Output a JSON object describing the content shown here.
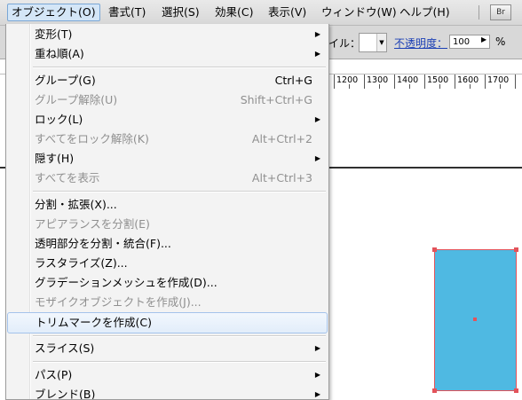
{
  "menubar": {
    "items": [
      {
        "label": "オブジェクト(O)",
        "active": true
      },
      {
        "label": "書式(T)"
      },
      {
        "label": "選択(S)"
      },
      {
        "label": "効果(C)"
      },
      {
        "label": "表示(V)"
      },
      {
        "label": "ウィンドウ(W)"
      },
      {
        "label": "ヘルプ(H)"
      }
    ],
    "bridge_label": "Br"
  },
  "controlbar": {
    "style_label": "イル：",
    "opacity_label": "不透明度：",
    "opacity_value": "100",
    "percent": "%"
  },
  "ruler": {
    "labels": [
      "1200",
      "1300",
      "1400",
      "1500",
      "1600",
      "1700"
    ]
  },
  "menu": {
    "items": [
      {
        "label": "変形(T)",
        "submenu": true
      },
      {
        "label": "重ね順(A)",
        "submenu": true
      },
      {
        "label": "グループ(G)",
        "shortcut": "Ctrl+G"
      },
      {
        "label": "グループ解除(U)",
        "shortcut": "Shift+Ctrl+G",
        "disabled": true
      },
      {
        "label": "ロック(L)",
        "submenu": true
      },
      {
        "label": "すべてをロック解除(K)",
        "shortcut": "Alt+Ctrl+2",
        "disabled": true
      },
      {
        "label": "隠す(H)",
        "submenu": true
      },
      {
        "label": "すべてを表示",
        "shortcut": "Alt+Ctrl+3",
        "disabled": true
      },
      {
        "label": "分割・拡張(X)..."
      },
      {
        "label": "アピアランスを分割(E)",
        "disabled": true
      },
      {
        "label": "透明部分を分割・統合(F)..."
      },
      {
        "label": "ラスタライズ(Z)..."
      },
      {
        "label": "グラデーションメッシュを作成(D)..."
      },
      {
        "label": "モザイクオブジェクトを作成(J)...",
        "disabled": true
      },
      {
        "label": "トリムマークを作成(C)",
        "highlighted": true
      },
      {
        "label": "スライス(S)",
        "submenu": true
      },
      {
        "label": "パス(P)",
        "submenu": true
      },
      {
        "label": "ブレンド(B)",
        "submenu": true
      }
    ]
  },
  "colors": {
    "artwork_fill": "#4fb9e2",
    "selection": "#e3535a",
    "highlight": "#e2edfa"
  }
}
